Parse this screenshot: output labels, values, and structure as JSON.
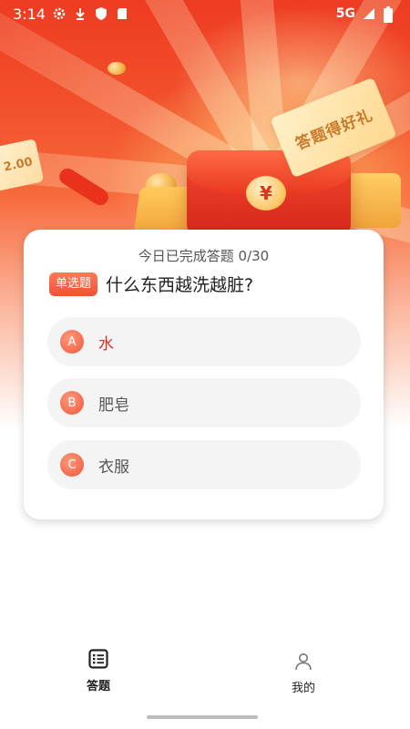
{
  "status_bar": {
    "time": "3:14",
    "network": "5G",
    "icons": [
      "gear-icon",
      "download-icon",
      "shield-icon",
      "sd-card-icon",
      "signal-icon",
      "battery-icon"
    ]
  },
  "hero": {
    "ticket_text": "答题得好礼",
    "ticket_left_text": "2.00",
    "envelope_symbol": "¥"
  },
  "quiz": {
    "progress": "今日已完成答题 0/30",
    "type_label": "单选题",
    "question": "什么东西越洗越脏?",
    "options": [
      {
        "letter": "A",
        "text": "水",
        "selected": true
      },
      {
        "letter": "B",
        "text": "肥皂",
        "selected": false
      },
      {
        "letter": "C",
        "text": "衣服",
        "selected": false
      }
    ]
  },
  "nav": {
    "items": [
      {
        "label": "答题",
        "icon": "list-icon",
        "active": true
      },
      {
        "label": "我的",
        "icon": "person-icon",
        "active": false
      }
    ]
  },
  "colors": {
    "accent": "#f0513a",
    "selected_text": "#d6301e",
    "option_bg": "#f4f4f4"
  }
}
